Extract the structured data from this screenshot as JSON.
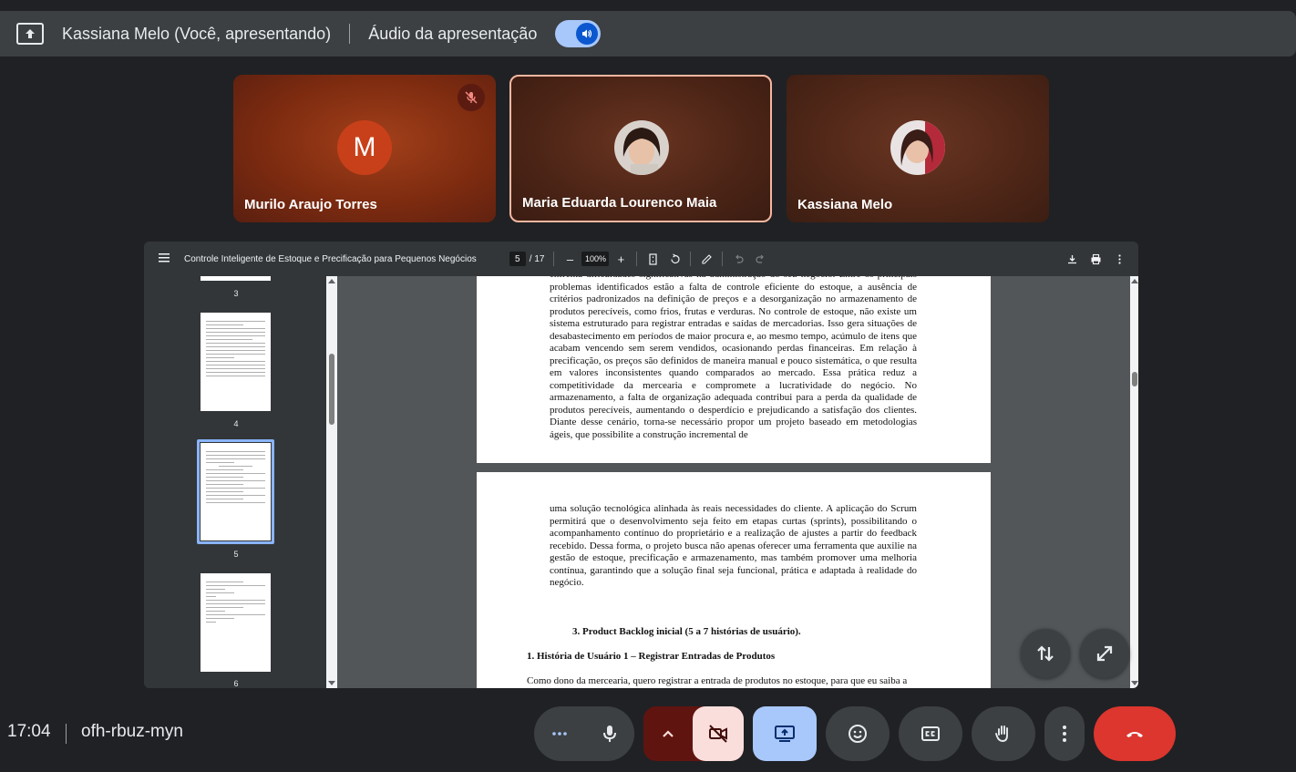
{
  "topbar": {
    "presenter": "Kassiana Melo (Você, apresentando)",
    "audio_label": "Áudio da apresentação"
  },
  "participants": [
    {
      "name": "Murilo Araujo Torres",
      "initial": "M",
      "muted": true
    },
    {
      "name": "Maria Eduarda Lourenco Maia",
      "active_speaker": true
    },
    {
      "name": "Kassiana Melo"
    }
  ],
  "pdf": {
    "title": "Controle Inteligente de Estoque e Precificação para Pequenos Negócios",
    "current_page": "5",
    "total_pages": "/ 17",
    "zoom": "100%",
    "thumbnails": [
      "3",
      "4",
      "5",
      "6"
    ],
    "selected_thumbnail": "5",
    "page_a_text": "enfrenta dificuldades significativas na administração do seu negócio. Entre os principais problemas identificados estão a falta de controle eficiente do estoque, a ausência de critérios padronizados na definição de preços e a desorganização no armazenamento de produtos perecíveis, como frios, frutas e verduras. No controle de estoque, não existe um sistema estruturado para registrar entradas e saídas de mercadorias. Isso gera situações de desabastecimento em períodos de maior procura e, ao mesmo tempo, acúmulo de itens que acabam vencendo sem serem vendidos, ocasionando perdas financeiras. Em relação à precificação, os preços são definidos de maneira manual e pouco sistemática, o que resulta em valores inconsistentes quando comparados ao mercado. Essa prática reduz a competitividade da mercearia e compromete a lucratividade do negócio. No armazenamento, a falta de organização adequada contribui para a perda da qualidade de produtos perecíveis, aumentando o desperdício e prejudicando a satisfação dos clientes. Diante desse cenário, torna-se necessário propor um projeto baseado em metodologias ágeis, que possibilite a construção incremental de",
    "page_b_text": "uma solução tecnológica alinhada às reais necessidades do cliente. A aplicação do Scrum permitirá que o desenvolvimento seja feito em etapas curtas (sprints), possibilitando o acompanhamento contínuo do proprietário e a realização de ajustes a partir do feedback recebido. Dessa forma, o projeto busca não apenas oferecer uma ferramenta que auxilie na gestão de estoque, precificação e armazenamento, mas também promover uma melhoria contínua, garantindo que a solução final seja funcional, prática e adaptada à realidade do negócio.",
    "heading_backlog": "3. Product Backlog inicial (5 a 7 histórias de usuário).",
    "heading_story1": "1. História de Usuário 1 – Registrar Entradas de Produtos",
    "story1_text": "Como dono da mercearia, quero registrar a entrada de produtos no estoque, para que eu saiba a"
  },
  "footer": {
    "time": "17:04",
    "meeting_code": "ofh-rbuz-myn"
  },
  "colors": {
    "end_call": "#e53935",
    "camera_off_bg": "#f9dedc",
    "camera_more_bg": "#601410",
    "present_bg": "#a8c7fa",
    "button_bg": "#3c4043"
  }
}
